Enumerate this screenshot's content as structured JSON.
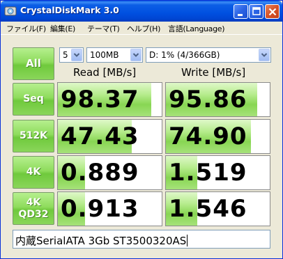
{
  "window": {
    "title": "CrystalDiskMark 3.0"
  },
  "menu": [
    {
      "label": "ファイル(F)"
    },
    {
      "label": "編集(E)"
    },
    {
      "label": "テーマ(T)"
    },
    {
      "label": "ヘルプ(H)"
    },
    {
      "label": "言語(Language)"
    }
  ],
  "controls": {
    "all_button": "All",
    "count_select": "5",
    "size_select": "100MB",
    "drive_select": "D: 1% (4/366GB)"
  },
  "columns": {
    "read": "Read [MB/s]",
    "write": "Write [MB/s]"
  },
  "rows": [
    {
      "label_line1": "Seq",
      "label_line2": "",
      "read": "98.37",
      "write": "95.86",
      "read_fill": 0.9,
      "write_fill": 0.88
    },
    {
      "label_line1": "512K",
      "label_line2": "",
      "read": "47.43",
      "write": "74.90",
      "read_fill": 0.71,
      "write_fill": 0.82
    },
    {
      "label_line1": "4K",
      "label_line2": "",
      "read": "0.889",
      "write": "1.519",
      "read_fill": 0.26,
      "write_fill": 0.3
    },
    {
      "label_line1": "4K",
      "label_line2": "QD32",
      "read": "0.913",
      "write": "1.546",
      "read_fill": 0.26,
      "write_fill": 0.3
    }
  ],
  "comment": "内蔵SerialATA 3Gb ST3500320AS",
  "colors": {
    "titlebar": "#0050e0",
    "button_green": "#8edc5c",
    "bar_green": "#88d653",
    "window_bg": "#ece9d8"
  }
}
